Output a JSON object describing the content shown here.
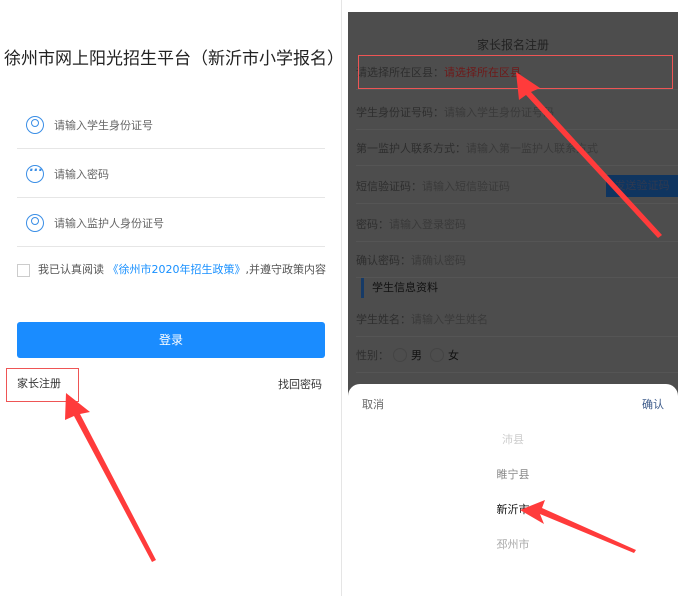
{
  "login": {
    "title": "徐州市网上阳光招生平台（新沂市小学报名）",
    "student_id_placeholder": "请输入学生身份证号",
    "password_placeholder": "请输入密码",
    "guardian_id_placeholder": "请输入监护人身份证号",
    "agree_prefix": "我已认真阅读",
    "policy_link": "《徐州市2020年招生政策》",
    "agree_suffix": ",并遵守政策内容",
    "login_button": "登录",
    "register_link": "家长注册",
    "forgot_link": "找回密码"
  },
  "register": {
    "title": "家长报名注册",
    "rows": [
      {
        "label": "请选择所在区县：",
        "value": "请选择所在区县"
      },
      {
        "label": "学生身份证号码：",
        "value": "请输入学生身份证号码"
      },
      {
        "label": "第一监护人联系方式：",
        "value": "请输入第一监护人联系方式"
      },
      {
        "label": "短信验证码：",
        "value": "请输入短信验证码"
      },
      {
        "label": "密码：",
        "value": "请输入登录密码"
      },
      {
        "label": "确认密码：",
        "value": "请确认密码"
      }
    ],
    "send_code": "发送验证码",
    "section": "学生信息资料",
    "name_label": "学生姓名：",
    "name_placeholder": "请输入学生姓名",
    "gender_label": "性别：",
    "male": "男",
    "female": "女"
  },
  "picker": {
    "cancel": "取消",
    "confirm": "确认",
    "options": [
      "沛县",
      "睢宁县",
      "新沂市",
      "邳州市"
    ],
    "selected": "新沂市"
  },
  "colors": {
    "primary": "#1a8cff",
    "annotation": "#ff3b3b"
  }
}
